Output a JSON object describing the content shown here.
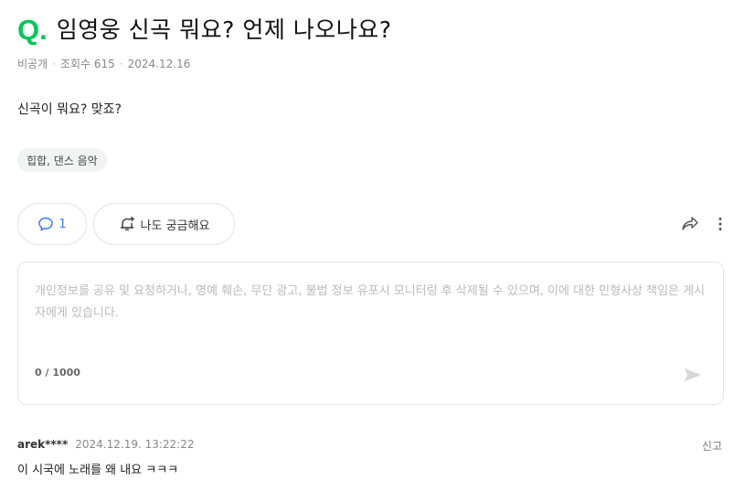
{
  "question": {
    "mark": "Q.",
    "title": "임영웅 신곡 뭐요? 언제 나오나요?",
    "meta": {
      "visibility": "비공개",
      "views": "조회수 615",
      "date": "2024.12.16"
    },
    "body": "신곡이 뭐요? 맞죠?",
    "tag": "힙합, 댄스 음악"
  },
  "actions": {
    "comment_count": "1",
    "curious_label": "나도 궁금해요"
  },
  "composer": {
    "placeholder": "개인정보를 공유 및 요청하거나, 명예 훼손, 무단 광고, 불법 정보 유포시 모니터링 후 삭제될 수 있으며, 이에 대한 민형사상 책임은 게시자에게 있습니다.",
    "value": "",
    "counter": "0 / 1000"
  },
  "reply": {
    "user": "arek****",
    "datetime": "2024.12.19. 13:22:22",
    "report_label": "신고",
    "text": "이 시국에 노래를 왜 내요 ㅋㅋㅋ"
  },
  "colors": {
    "brand_green": "#03c75a",
    "count_blue": "#3a7bef",
    "border": "#e3e4e6"
  },
  "icons": [
    "comment-icon",
    "bell-plus-icon",
    "share-icon",
    "more-icon",
    "send-icon"
  ]
}
